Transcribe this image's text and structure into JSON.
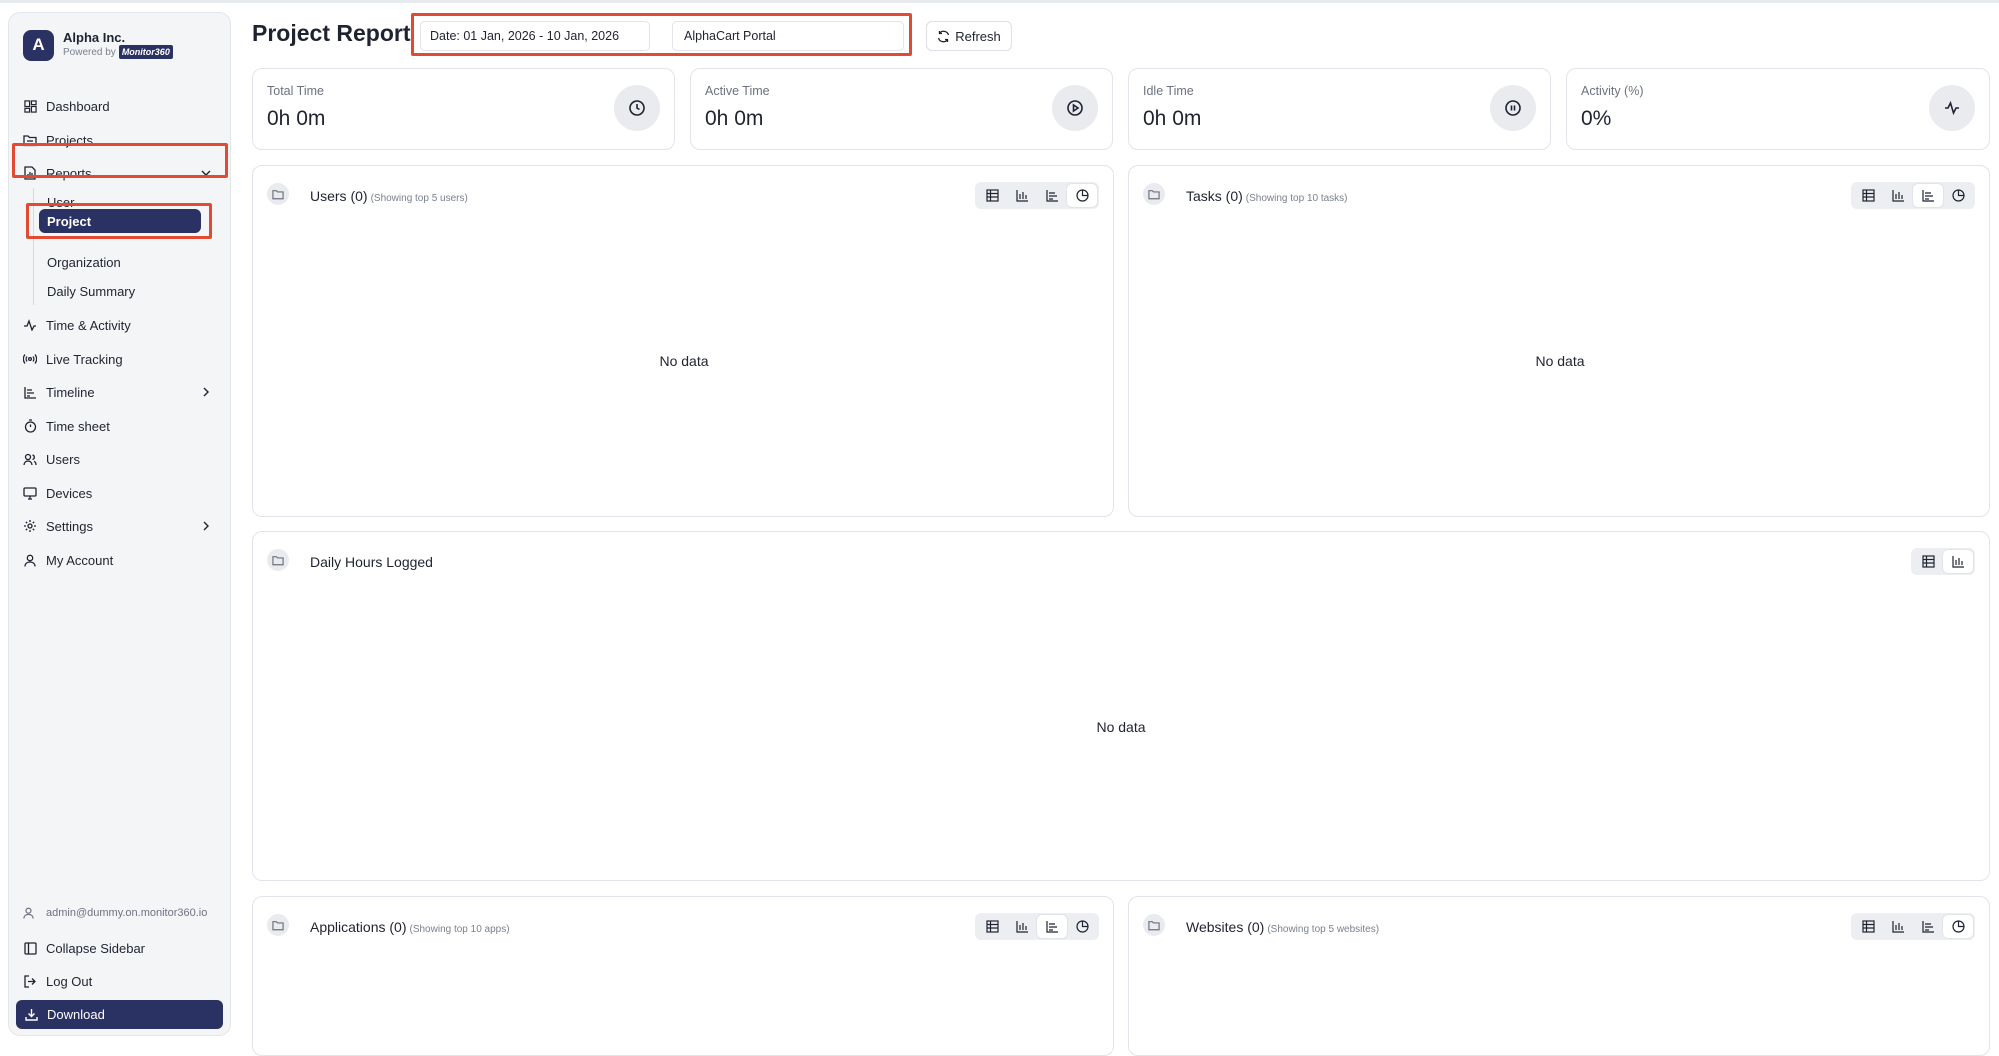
{
  "brand": {
    "initial": "A",
    "name": "Alpha Inc.",
    "powered_by": "Powered by",
    "product": "Monitor360"
  },
  "nav": {
    "dashboard": "Dashboard",
    "projects": "Projects",
    "reports": "Reports",
    "reports_sub": {
      "user": "User",
      "project": "Project",
      "organization": "Organization",
      "daily_summary": "Daily Summary"
    },
    "time_activity": "Time & Activity",
    "live_tracking": "Live Tracking",
    "timeline": "Timeline",
    "timesheet": "Time sheet",
    "users": "Users",
    "devices": "Devices",
    "settings": "Settings",
    "my_account": "My Account"
  },
  "footer": {
    "email": "admin@dummy.on.monitor360.io",
    "collapse": "Collapse Sidebar",
    "logout": "Log Out",
    "download": "Download"
  },
  "header": {
    "title": "Project Report",
    "date_range": "Date: 01 Jan, 2026 - 10 Jan, 2026",
    "project": "AlphaCart Portal",
    "refresh": "Refresh"
  },
  "stats": [
    {
      "label": "Total Time",
      "value": "0h 0m",
      "icon": "clock-icon"
    },
    {
      "label": "Active Time",
      "value": "0h 0m",
      "icon": "play-circle-icon"
    },
    {
      "label": "Idle Time",
      "value": "0h 0m",
      "icon": "pause-circle-icon"
    },
    {
      "label": "Activity (%)",
      "value": "0%",
      "icon": "activity-icon"
    }
  ],
  "panels": {
    "users": {
      "title": "Users (0)",
      "subtitle": "(Showing top 5 users)",
      "empty": "No data",
      "active_view": "pie"
    },
    "tasks": {
      "title": "Tasks (0)",
      "subtitle": "(Showing top 10 tasks)",
      "empty": "No data",
      "active_view": "horizontal-bar"
    },
    "daily": {
      "title": "Daily Hours Logged",
      "empty": "No data",
      "active_view": "bar"
    },
    "applications": {
      "title": "Applications (0)",
      "subtitle": "(Showing top 10 apps)",
      "active_view": "horizontal-bar"
    },
    "websites": {
      "title": "Websites (0)",
      "subtitle": "(Showing top 5 websites)",
      "active_view": "pie"
    }
  },
  "colors": {
    "brand": "#2a3163",
    "highlight": "#e24a33"
  }
}
